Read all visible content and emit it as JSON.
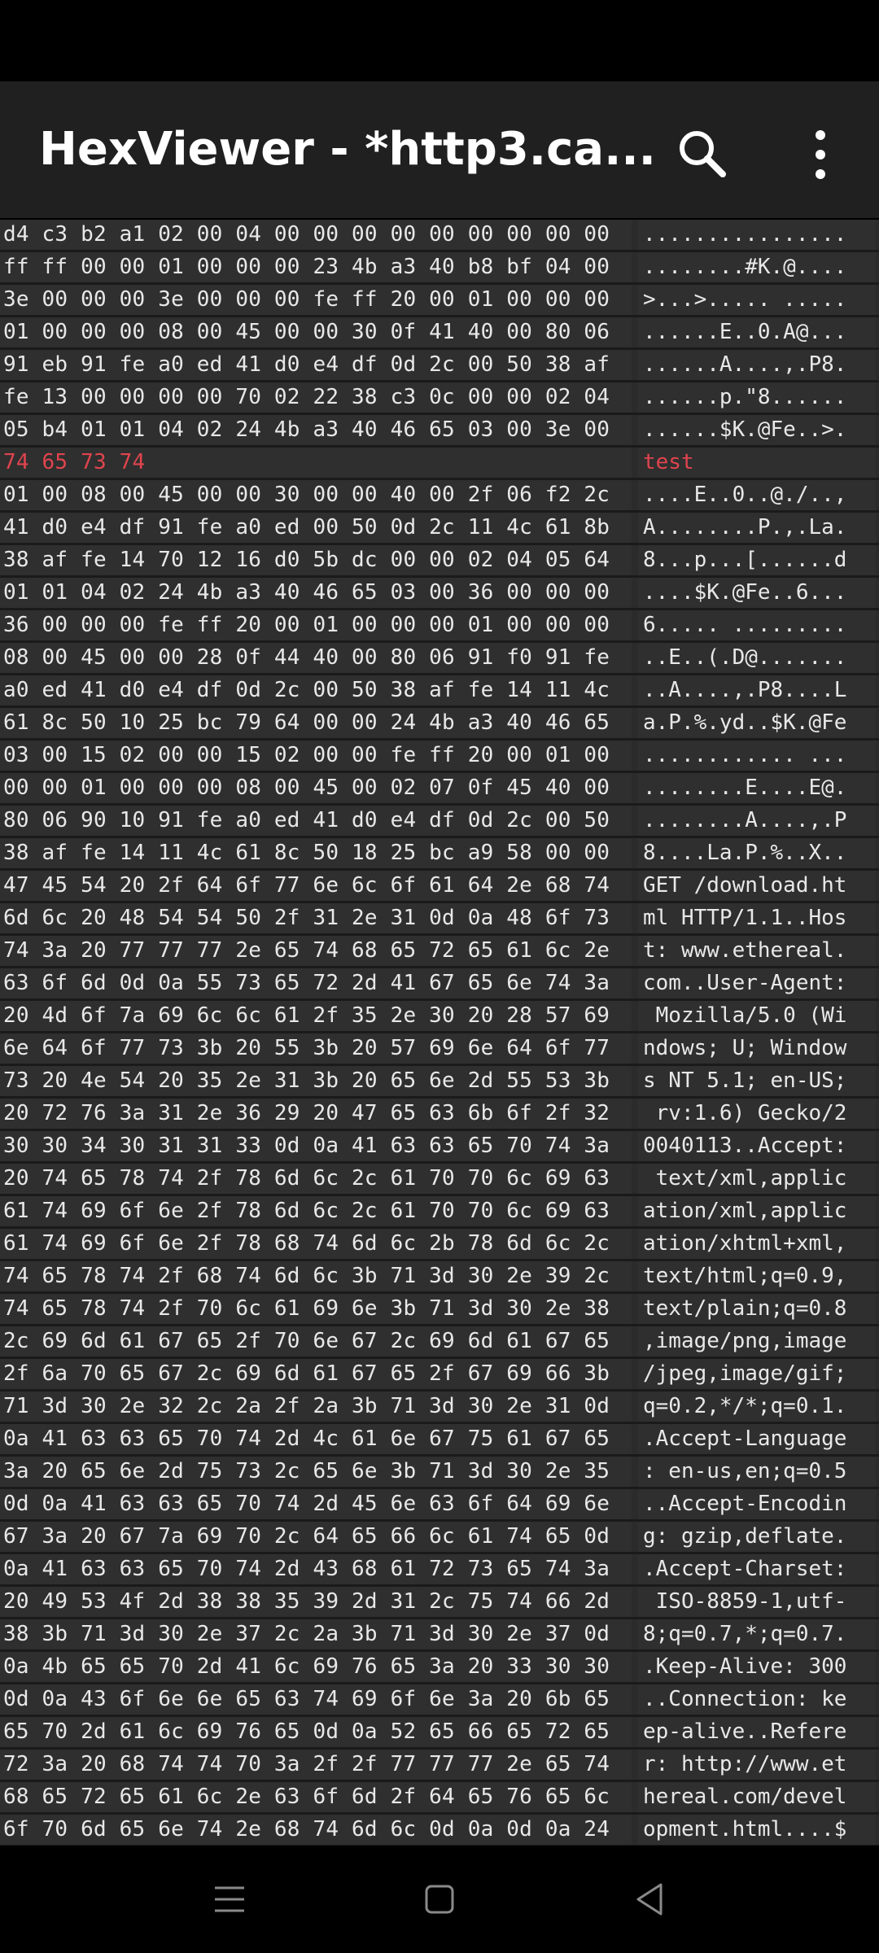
{
  "app": {
    "title": "HexViewer - *http3.ca..."
  },
  "icons": {
    "search": "search-icon",
    "more": "more-vert-icon",
    "nav_menu": "nav-menu-icon",
    "nav_home": "nav-home-icon",
    "nav_back": "nav-back-icon"
  },
  "colors": {
    "toolbar": "#202020",
    "row_bg": "#2f2f2f",
    "text": "#e8e8e8",
    "highlight": "#e0444e"
  },
  "rows": [
    {
      "hex": "d4 c3 b2 a1 02 00 04 00 00 00 00 00 00 00 00 00",
      "ascii": "................"
    },
    {
      "hex": "ff ff 00 00 01 00 00 00 23 4b a3 40 b8 bf 04 00",
      "ascii": "........#K.@...."
    },
    {
      "hex": "3e 00 00 00 3e 00 00 00 fe ff 20 00 01 00 00 00",
      "ascii": ">...>..... ....."
    },
    {
      "hex": "01 00 00 00 08 00 45 00 00 30 0f 41 40 00 80 06",
      "ascii": "......E..0.A@..."
    },
    {
      "hex": "91 eb 91 fe a0 ed 41 d0 e4 df 0d 2c 00 50 38 af",
      "ascii": "......A....,.P8."
    },
    {
      "hex": "fe 13 00 00 00 00 70 02 22 38 c3 0c 00 00 02 04",
      "ascii": "......p.\"8......"
    },
    {
      "hex": "05 b4 01 01 04 02 24 4b a3 40 46 65 03 00 3e 00",
      "ascii": "......$K.@Fe..>."
    },
    {
      "hex": "74 65 73 74",
      "ascii": "test",
      "highlight": true
    },
    {
      "hex": "01 00 08 00 45 00 00 30 00 00 40 00 2f 06 f2 2c",
      "ascii": "....E..0..@./..,"
    },
    {
      "hex": "41 d0 e4 df 91 fe a0 ed 00 50 0d 2c 11 4c 61 8b",
      "ascii": "A........P.,.La."
    },
    {
      "hex": "38 af fe 14 70 12 16 d0 5b dc 00 00 02 04 05 64",
      "ascii": "8...p...[......d"
    },
    {
      "hex": "01 01 04 02 24 4b a3 40 46 65 03 00 36 00 00 00",
      "ascii": "....$K.@Fe..6..."
    },
    {
      "hex": "36 00 00 00 fe ff 20 00 01 00 00 00 01 00 00 00",
      "ascii": "6..... ........."
    },
    {
      "hex": "08 00 45 00 00 28 0f 44 40 00 80 06 91 f0 91 fe",
      "ascii": "..E..(.D@......."
    },
    {
      "hex": "a0 ed 41 d0 e4 df 0d 2c 00 50 38 af fe 14 11 4c",
      "ascii": "..A....,.P8....L"
    },
    {
      "hex": "61 8c 50 10 25 bc 79 64 00 00 24 4b a3 40 46 65",
      "ascii": "a.P.%.yd..$K.@Fe"
    },
    {
      "hex": "03 00 15 02 00 00 15 02 00 00 fe ff 20 00 01 00",
      "ascii": "............ ..."
    },
    {
      "hex": "00 00 01 00 00 00 08 00 45 00 02 07 0f 45 40 00",
      "ascii": "........E....E@."
    },
    {
      "hex": "80 06 90 10 91 fe a0 ed 41 d0 e4 df 0d 2c 00 50",
      "ascii": "........A....,.P"
    },
    {
      "hex": "38 af fe 14 11 4c 61 8c 50 18 25 bc a9 58 00 00",
      "ascii": "8....La.P.%..X.."
    },
    {
      "hex": "47 45 54 20 2f 64 6f 77 6e 6c 6f 61 64 2e 68 74",
      "ascii": "GET /download.ht"
    },
    {
      "hex": "6d 6c 20 48 54 54 50 2f 31 2e 31 0d 0a 48 6f 73",
      "ascii": "ml HTTP/1.1..Hos"
    },
    {
      "hex": "74 3a 20 77 77 77 2e 65 74 68 65 72 65 61 6c 2e",
      "ascii": "t: www.ethereal."
    },
    {
      "hex": "63 6f 6d 0d 0a 55 73 65 72 2d 41 67 65 6e 74 3a",
      "ascii": "com..User-Agent:"
    },
    {
      "hex": "20 4d 6f 7a 69 6c 6c 61 2f 35 2e 30 20 28 57 69",
      "ascii": " Mozilla/5.0 (Wi"
    },
    {
      "hex": "6e 64 6f 77 73 3b 20 55 3b 20 57 69 6e 64 6f 77",
      "ascii": "ndows; U; Window"
    },
    {
      "hex": "73 20 4e 54 20 35 2e 31 3b 20 65 6e 2d 55 53 3b",
      "ascii": "s NT 5.1; en-US;"
    },
    {
      "hex": "20 72 76 3a 31 2e 36 29 20 47 65 63 6b 6f 2f 32",
      "ascii": " rv:1.6) Gecko/2"
    },
    {
      "hex": "30 30 34 30 31 31 33 0d 0a 41 63 63 65 70 74 3a",
      "ascii": "0040113..Accept:"
    },
    {
      "hex": "20 74 65 78 74 2f 78 6d 6c 2c 61 70 70 6c 69 63",
      "ascii": " text/xml,applic"
    },
    {
      "hex": "61 74 69 6f 6e 2f 78 6d 6c 2c 61 70 70 6c 69 63",
      "ascii": "ation/xml,applic"
    },
    {
      "hex": "61 74 69 6f 6e 2f 78 68 74 6d 6c 2b 78 6d 6c 2c",
      "ascii": "ation/xhtml+xml,"
    },
    {
      "hex": "74 65 78 74 2f 68 74 6d 6c 3b 71 3d 30 2e 39 2c",
      "ascii": "text/html;q=0.9,"
    },
    {
      "hex": "74 65 78 74 2f 70 6c 61 69 6e 3b 71 3d 30 2e 38",
      "ascii": "text/plain;q=0.8"
    },
    {
      "hex": "2c 69 6d 61 67 65 2f 70 6e 67 2c 69 6d 61 67 65",
      "ascii": ",image/png,image"
    },
    {
      "hex": "2f 6a 70 65 67 2c 69 6d 61 67 65 2f 67 69 66 3b",
      "ascii": "/jpeg,image/gif;"
    },
    {
      "hex": "71 3d 30 2e 32 2c 2a 2f 2a 3b 71 3d 30 2e 31 0d",
      "ascii": "q=0.2,*/*;q=0.1."
    },
    {
      "hex": "0a 41 63 63 65 70 74 2d 4c 61 6e 67 75 61 67 65",
      "ascii": ".Accept-Language"
    },
    {
      "hex": "3a 20 65 6e 2d 75 73 2c 65 6e 3b 71 3d 30 2e 35",
      "ascii": ": en-us,en;q=0.5"
    },
    {
      "hex": "0d 0a 41 63 63 65 70 74 2d 45 6e 63 6f 64 69 6e",
      "ascii": "..Accept-Encodin"
    },
    {
      "hex": "67 3a 20 67 7a 69 70 2c 64 65 66 6c 61 74 65 0d",
      "ascii": "g: gzip,deflate."
    },
    {
      "hex": "0a 41 63 63 65 70 74 2d 43 68 61 72 73 65 74 3a",
      "ascii": ".Accept-Charset:"
    },
    {
      "hex": "20 49 53 4f 2d 38 38 35 39 2d 31 2c 75 74 66 2d",
      "ascii": " ISO-8859-1,utf-"
    },
    {
      "hex": "38 3b 71 3d 30 2e 37 2c 2a 3b 71 3d 30 2e 37 0d",
      "ascii": "8;q=0.7,*;q=0.7."
    },
    {
      "hex": "0a 4b 65 65 70 2d 41 6c 69 76 65 3a 20 33 30 30",
      "ascii": ".Keep-Alive: 300"
    },
    {
      "hex": "0d 0a 43 6f 6e 6e 65 63 74 69 6f 6e 3a 20 6b 65",
      "ascii": "..Connection: ke"
    },
    {
      "hex": "65 70 2d 61 6c 69 76 65 0d 0a 52 65 66 65 72 65",
      "ascii": "ep-alive..Refere"
    },
    {
      "hex": "72 3a 20 68 74 74 70 3a 2f 2f 77 77 77 2e 65 74",
      "ascii": "r: http://www.et"
    },
    {
      "hex": "68 65 72 65 61 6c 2e 63 6f 6d 2f 64 65 76 65 6c",
      "ascii": "hereal.com/devel"
    },
    {
      "hex": "6f 70 6d 65 6e 74 2e 68 74 6d 6c 0d 0a 0d 0a 24",
      "ascii": "opment.html....$"
    }
  ]
}
